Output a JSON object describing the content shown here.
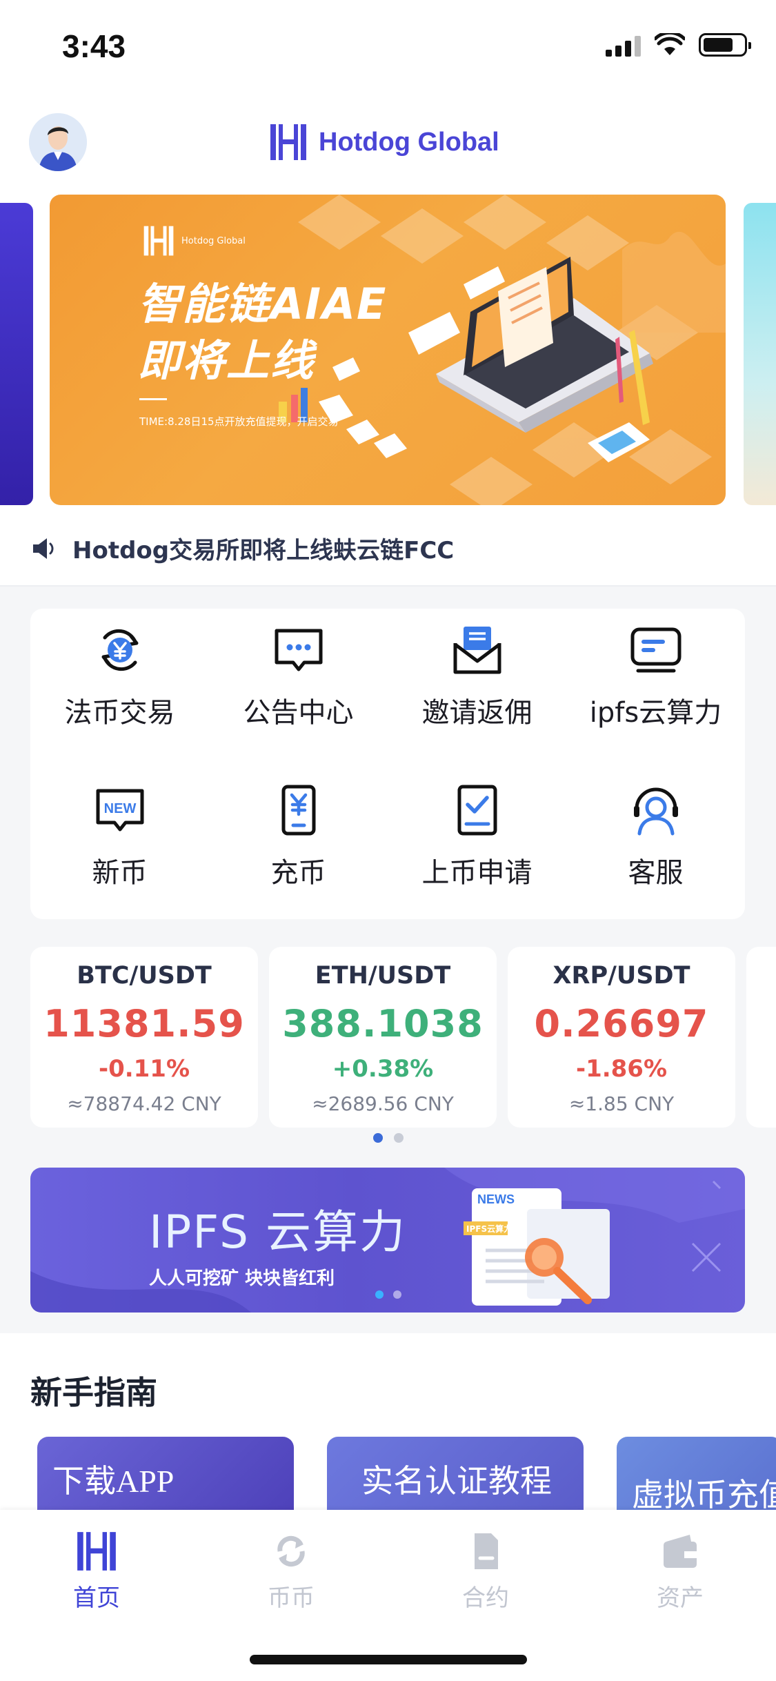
{
  "status_bar": {
    "time": "3:43"
  },
  "header": {
    "brand": "Hotdog Global"
  },
  "banner": {
    "logo_text": "Hotdog Global",
    "title_line1": "智能链AIAE",
    "title_line2": "即将上线",
    "subtitle": "TIME:8.28日15点开放充值提现，开启交易"
  },
  "notice": {
    "text": "Hotdog交易所即将上线蚨云链FCC"
  },
  "menu": {
    "items": [
      {
        "label": "法币交易",
        "icon": "yuan-exchange-icon"
      },
      {
        "label": "公告中心",
        "icon": "message-icon"
      },
      {
        "label": "邀请返佣",
        "icon": "mail-icon"
      },
      {
        "label": "ipfs云算力",
        "icon": "monitor-icon"
      },
      {
        "label": "新币",
        "icon": "new-badge-icon"
      },
      {
        "label": "充币",
        "icon": "phone-yuan-icon"
      },
      {
        "label": "上币申请",
        "icon": "checklist-icon"
      },
      {
        "label": "客服",
        "icon": "headset-icon"
      }
    ]
  },
  "tickers": [
    {
      "pair": "BTC/USDT",
      "price": "11381.59",
      "change": "-0.11%",
      "cny": "≈78874.42 CNY",
      "direction": "down"
    },
    {
      "pair": "ETH/USDT",
      "price": "388.1038",
      "change": "+0.38%",
      "cny": "≈2689.56 CNY",
      "direction": "up"
    },
    {
      "pair": "XRP/USDT",
      "price": "0.26697",
      "change": "-1.86%",
      "cny": "≈1.85 CNY",
      "direction": "down"
    }
  ],
  "ipfs_banner": {
    "title": "IPFS 云算力",
    "subtitle": "人人可挖矿 块块皆红利",
    "news_tag": "NEWS",
    "doc_tag": "IPFS云算力"
  },
  "guide": {
    "title": "新手指南",
    "cards": [
      "下载APP",
      "实名认证教程",
      "虚拟币充值"
    ]
  },
  "tabbar": {
    "tabs": [
      {
        "label": "首页",
        "icon": "home-logo-icon",
        "active": true
      },
      {
        "label": "币币",
        "icon": "swap-icon",
        "active": false
      },
      {
        "label": "合约",
        "icon": "contract-icon",
        "active": false
      },
      {
        "label": "资产",
        "icon": "wallet-icon",
        "active": false
      }
    ]
  },
  "colors": {
    "brand": "#4a45d6",
    "up": "#3eb07a",
    "down": "#e5534b",
    "banner_orange": "#f5a942"
  }
}
